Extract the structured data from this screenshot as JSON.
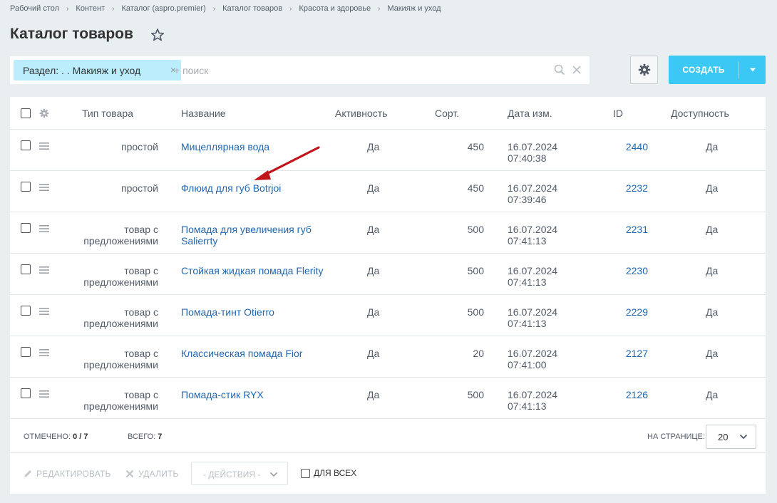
{
  "breadcrumbs": [
    "Рабочий стол",
    "Контент",
    "Каталог (aspro.premier)",
    "Каталог товаров",
    "Красота и здоровье",
    "Макияж и уход"
  ],
  "page_title": "Каталог товаров",
  "filter": {
    "tag_label": "Раздел: . . Макияж и уход",
    "search_placeholder": "+ поиск"
  },
  "toolbar": {
    "create_label": "СОЗДАТЬ"
  },
  "grid": {
    "columns": {
      "type": "Тип товара",
      "name": "Название",
      "active": "Активность",
      "sort": "Сорт.",
      "date": "Дата изм.",
      "id": "ID",
      "availability": "Доступность"
    },
    "rows": [
      {
        "type_line1": "простой",
        "type_line2": "",
        "name": "Мицеллярная вода",
        "active": "Да",
        "sort": "450",
        "date": "16.07.2024",
        "time": "07:40:38",
        "id": "2440",
        "availability": "Да"
      },
      {
        "type_line1": "простой",
        "type_line2": "",
        "name": "Флюид для губ Botrjoi",
        "active": "Да",
        "sort": "450",
        "date": "16.07.2024",
        "time": "07:39:46",
        "id": "2232",
        "availability": "Да"
      },
      {
        "type_line1": "товар с",
        "type_line2": "предложениями",
        "name": "Помада для увеличения губ Salierrty",
        "active": "Да",
        "sort": "500",
        "date": "16.07.2024",
        "time": "07:41:13",
        "id": "2231",
        "availability": "Да"
      },
      {
        "type_line1": "товар с",
        "type_line2": "предложениями",
        "name": "Стойкая жидкая помада Flerity",
        "active": "Да",
        "sort": "500",
        "date": "16.07.2024",
        "time": "07:41:13",
        "id": "2230",
        "availability": "Да"
      },
      {
        "type_line1": "товар с",
        "type_line2": "предложениями",
        "name": "Помада-тинт Otierro",
        "active": "Да",
        "sort": "500",
        "date": "16.07.2024",
        "time": "07:41:13",
        "id": "2229",
        "availability": "Да"
      },
      {
        "type_line1": "товар с",
        "type_line2": "предложениями",
        "name": "Классическая помада Fior",
        "active": "Да",
        "sort": "20",
        "date": "16.07.2024",
        "time": "07:41:00",
        "id": "2127",
        "availability": "Да"
      },
      {
        "type_line1": "товар с",
        "type_line2": "предложениями",
        "name": "Помада-стик RYX",
        "active": "Да",
        "sort": "500",
        "date": "16.07.2024",
        "time": "07:41:13",
        "id": "2126",
        "availability": "Да"
      }
    ]
  },
  "footer": {
    "selected_label": "ОТМЕЧЕНО:",
    "selected_value": "0 / 7",
    "total_label": "ВСЕГО:",
    "total_value": "7",
    "per_page_label": "НА СТРАНИЦЕ:",
    "per_page_value": "20"
  },
  "actions": {
    "edit_label": "РЕДАКТИРОВАТЬ",
    "delete_label": "УДАЛИТЬ",
    "actions_select": "- ДЕЙСТВИЯ -",
    "for_all_label": "ДЛЯ ВСЕХ"
  },
  "colors": {
    "accent": "#3bc8f5",
    "filter_tag": "#bcedfc",
    "link": "#2067b0",
    "annotation": "#c0141b"
  }
}
